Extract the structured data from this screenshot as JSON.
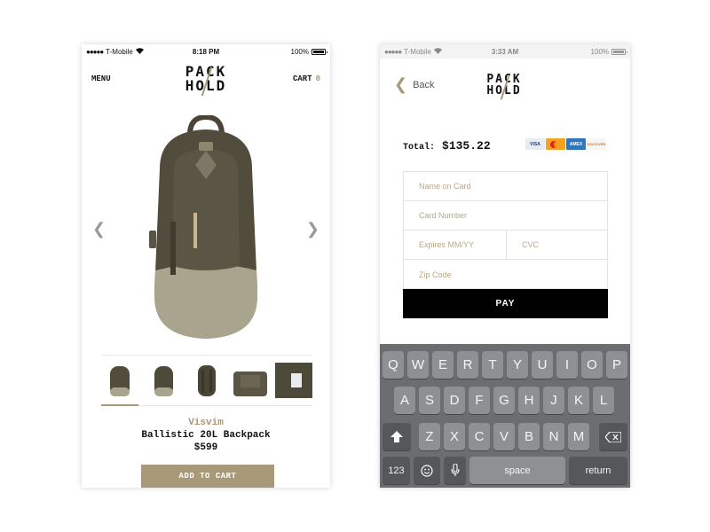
{
  "left_phone": {
    "status": {
      "carrier": "T-Mobile",
      "time": "8:18 PM",
      "battery": "100%"
    },
    "logo": {
      "line1": "PACK",
      "line2": "HOLD"
    },
    "menu_label": "MENU",
    "cart_label": "CART",
    "cart_count": "0",
    "product": {
      "brand": "Visvim",
      "name": "Ballistic 20L Backpack",
      "price": "$599"
    },
    "add_to_cart_label": "ADD TO CART",
    "thumbnail_count": 5,
    "active_thumbnail": 1
  },
  "right_phone": {
    "status": {
      "carrier": "T-Mobile",
      "time": "3:33 AM",
      "battery": "100%"
    },
    "logo": {
      "line1": "PACK",
      "line2": "HOLD"
    },
    "back_label": "Back",
    "total_label": "Total:",
    "total_value": "$135.22",
    "card_brands": [
      "VISA",
      "MC",
      "AMEX",
      "DISCOVER"
    ],
    "placeholders": {
      "name": "Name on Card",
      "number": "Card Number",
      "expires": "Expires MM/YY",
      "cvc": "CVC",
      "zip": "Zip Code"
    },
    "pay_label": "PAY",
    "keyboard": {
      "row1": [
        "Q",
        "W",
        "E",
        "R",
        "T",
        "Y",
        "U",
        "I",
        "O",
        "P"
      ],
      "row2": [
        "A",
        "S",
        "D",
        "F",
        "G",
        "H",
        "J",
        "K",
        "L"
      ],
      "row3": [
        "Z",
        "X",
        "C",
        "V",
        "B",
        "N",
        "M"
      ],
      "num_label": "123",
      "space_label": "space",
      "return_label": "return"
    }
  },
  "colors": {
    "accent": "#a89a78",
    "pay_button": "#000000",
    "keyboard_bg": "#6b6d71",
    "key": "#8e9094"
  }
}
